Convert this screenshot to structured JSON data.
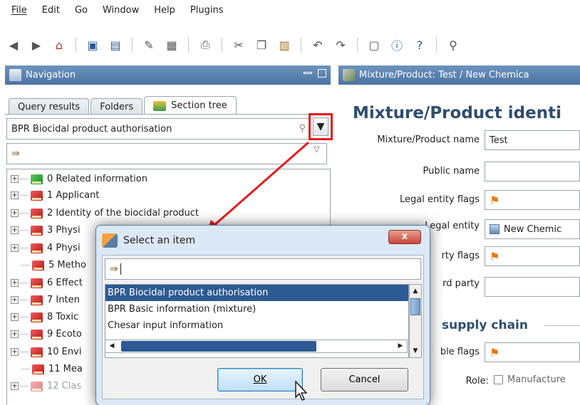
{
  "menu": {
    "items": [
      {
        "label": "File"
      },
      {
        "label": "Edit"
      },
      {
        "label": "Go"
      },
      {
        "label": "Window"
      },
      {
        "label": "Help"
      },
      {
        "label": "Plugins"
      }
    ]
  },
  "toolbar": {
    "icons": [
      "back-icon",
      "forward-icon",
      "home-icon",
      "save-icon",
      "save-all-icon",
      "edit-icon",
      "preview-icon",
      "print-icon",
      "cut-icon",
      "copy-icon",
      "paste-icon",
      "undo-icon",
      "redo-icon",
      "document-icon",
      "info-icon",
      "help-icon",
      "link-icon"
    ]
  },
  "navigation": {
    "title": "Navigation",
    "tabs": [
      {
        "label": "Query results"
      },
      {
        "label": "Folders"
      },
      {
        "label": "Section tree"
      }
    ],
    "template_value": "BPR Biocidal product authorisation",
    "filter_value": "",
    "tree": [
      {
        "label": "0 Related information",
        "color": "green"
      },
      {
        "label": "1 Applicant",
        "color": "red"
      },
      {
        "label": "2 Identity of the biocidal product",
        "color": "red"
      },
      {
        "label": "3 Physi",
        "color": "red"
      },
      {
        "label": "4 Physi",
        "color": "red"
      },
      {
        "label": "5 Metho",
        "color": "red"
      },
      {
        "label": "6 Effect",
        "color": "red"
      },
      {
        "label": "7 Inten",
        "color": "red"
      },
      {
        "label": "8 Toxic",
        "color": "red"
      },
      {
        "label": "9 Ecoto",
        "color": "red"
      },
      {
        "label": "10 Envi",
        "color": "red"
      },
      {
        "label": "11 Mea",
        "color": "red"
      },
      {
        "label": "12 Clas",
        "color": "red"
      }
    ]
  },
  "document": {
    "header": "Mixture/Product: Test / New Chemica",
    "title": "Mixture/Product identi",
    "fields": {
      "name_label": "Mixture/Product name",
      "name_value": "Test",
      "public_label": "Public name",
      "public_value": "",
      "lef_label": "Legal entity flags",
      "le_label": "Legal entity",
      "le_value": "New Chemic",
      "tpf_label": "rty flags",
      "tp_label": "rd party",
      "supply_title": "supply chain",
      "role_flags_label": "ble flags",
      "role_label": "Role:",
      "role_value": "Manufacture"
    }
  },
  "dialog": {
    "title": "Select an item",
    "close_label": "x",
    "filter_value": "",
    "items": [
      {
        "label": "BPR Biocidal product authorisation",
        "selected": true
      },
      {
        "label": "BPR Basic information (mixture)",
        "selected": false
      },
      {
        "label": "Chesar input information",
        "selected": false
      }
    ],
    "ok_label": "OK",
    "cancel_label": "Cancel"
  },
  "colors": {
    "header": "#4b74a3",
    "selection": "#2d5a93",
    "highlight": "#e81c1c",
    "title": "#2f4d6e"
  }
}
